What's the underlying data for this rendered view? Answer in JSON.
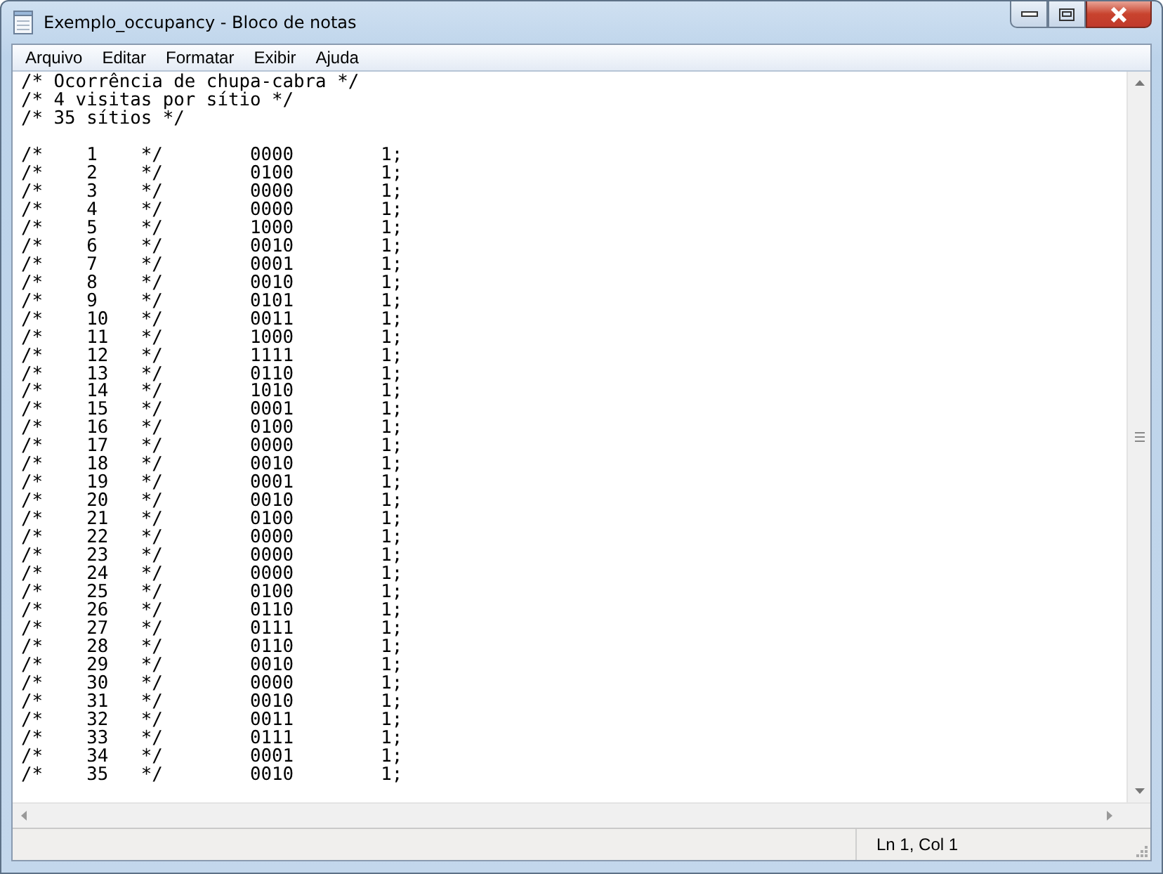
{
  "window": {
    "title": "Exemplo_occupancy - Bloco de notas"
  },
  "menu": [
    "Arquivo",
    "Editar",
    "Formatar",
    "Exibir",
    "Ajuda"
  ],
  "editor": {
    "lines": [
      "/* Ocorrência de chupa-cabra */",
      "/* 4 visitas por sítio */",
      "/* 35 sítios */"
    ],
    "rows": [
      "/*    1    */        0000        1;",
      "/*    2    */        0100        1;",
      "/*    3    */        0000        1;",
      "/*    4    */        0000        1;",
      "/*    5    */        1000        1;",
      "/*    6    */        0010        1;",
      "/*    7    */        0001        1;",
      "/*    8    */        0010        1;",
      "/*    9    */        0101        1;",
      "/*    10   */        0011        1;",
      "/*    11   */        1000        1;",
      "/*    12   */        1111        1;",
      "/*    13   */        0110        1;",
      "/*    14   */        1010        1;",
      "/*    15   */        0001        1;",
      "/*    16   */        0100        1;",
      "/*    17   */        0000        1;",
      "/*    18   */        0010        1;",
      "/*    19   */        0001        1;",
      "/*    20   */        0010        1;",
      "/*    21   */        0100        1;",
      "/*    22   */        0000        1;",
      "/*    23   */        0000        1;",
      "/*    24   */        0000        1;",
      "/*    25   */        0100        1;",
      "/*    26   */        0110        1;",
      "/*    27   */        0111        1;",
      "/*    28   */        0110        1;",
      "/*    29   */        0010        1;",
      "/*    30   */        0000        1;",
      "/*    31   */        0010        1;",
      "/*    32   */        0011        1;",
      "/*    33   */        0111        1;",
      "/*    34   */        0001        1;",
      "/*    35   */        0010        1;"
    ]
  },
  "status_bar": {
    "position": "Ln 1, Col 1"
  }
}
